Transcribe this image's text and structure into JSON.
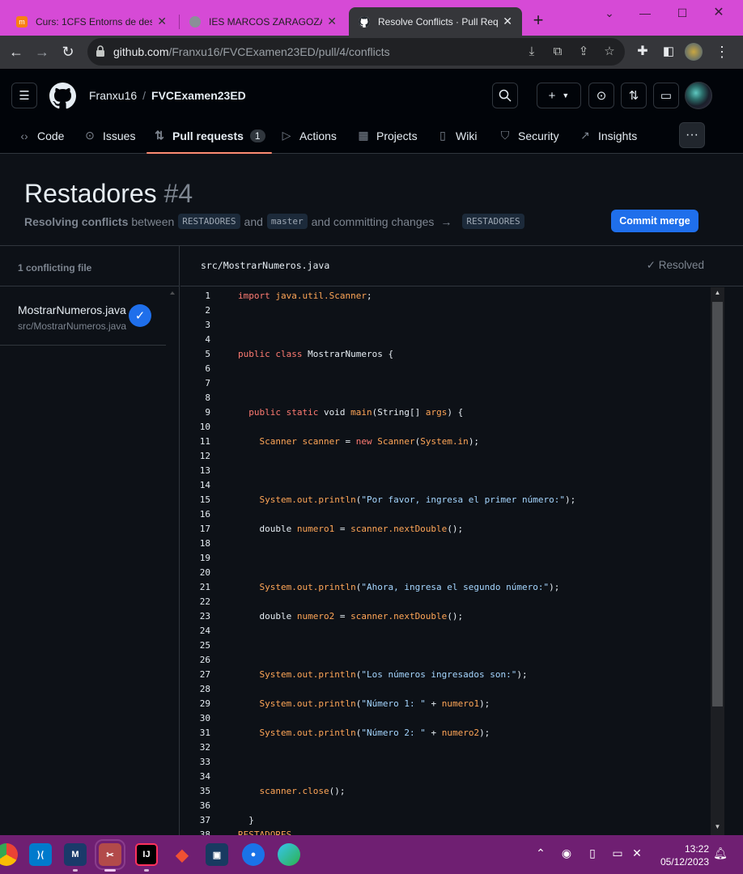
{
  "browser": {
    "tabs": [
      {
        "title": "Curs: 1CFS Entorns de dese",
        "icon": "moodle-icon"
      },
      {
        "title": "IES MARCOS ZARAGOZA",
        "icon": "globe-icon"
      },
      {
        "title": "Resolve Conflicts · Pull Requ",
        "icon": "github-icon"
      }
    ],
    "new_tab": "+",
    "url_host": "github.com",
    "url_path": "/Franxu16/FVCExamen23ED/pull/4/conflicts"
  },
  "github": {
    "owner": "Franxu16",
    "separator": "/",
    "repo": "FVCExamen23ED",
    "nav": {
      "code": "Code",
      "issues": "Issues",
      "pulls": "Pull requests",
      "pulls_count": "1",
      "actions": "Actions",
      "projects": "Projects",
      "wiki": "Wiki",
      "security": "Security",
      "insights": "Insights"
    },
    "title": "Restadores",
    "number": "#4",
    "sub_resolving": "Resolving conflicts",
    "sub_between": "between",
    "head_branch": "RESTADORES",
    "sub_and": "and",
    "base_branch": "master",
    "sub_committing": "and committing changes",
    "target_branch": "RESTADORES",
    "commit_button": "Commit merge",
    "sidebar_header": "1 conflicting file",
    "file": {
      "name": "MostrarNumeros.java",
      "path": "src/MostrarNumeros.java"
    },
    "editor_path": "src/MostrarNumeros.java",
    "resolved_label": "Resolved"
  },
  "code_lines": [
    {
      "n": "1",
      "html": "<span class=\"kw\">import</span> <span class=\"ty\">java.util.Scanner</span>;"
    },
    {
      "n": "2",
      "html": ""
    },
    {
      "n": "3",
      "html": ""
    },
    {
      "n": "4",
      "html": ""
    },
    {
      "n": "5",
      "html": "<span class=\"kw\">public</span> <span class=\"kw\">class</span> MostrarNumeros {"
    },
    {
      "n": "6",
      "html": ""
    },
    {
      "n": "7",
      "html": ""
    },
    {
      "n": "8",
      "html": ""
    },
    {
      "n": "9",
      "html": "  <span class=\"kw\">public</span> <span class=\"kw\">static</span> void <span class=\"ty\">main</span>(String[] <span class=\"vr\">args</span>) {"
    },
    {
      "n": "10",
      "html": ""
    },
    {
      "n": "11",
      "html": "    <span class=\"ty\">Scanner</span> <span class=\"ty\">scanner</span> = <span class=\"kw\">new</span> <span class=\"ty\">Scanner</span>(<span class=\"ty\">System.in</span>);"
    },
    {
      "n": "12",
      "html": ""
    },
    {
      "n": "13",
      "html": ""
    },
    {
      "n": "14",
      "html": ""
    },
    {
      "n": "15",
      "html": "    <span class=\"ty\">System.out.println</span>(<span class=\"st\">\"Por favor, ingresa el primer número:\"</span>);"
    },
    {
      "n": "16",
      "html": ""
    },
    {
      "n": "17",
      "html": "    double <span class=\"vr\">numero1</span> = <span class=\"ty\">scanner.nextDouble</span>();"
    },
    {
      "n": "18",
      "html": ""
    },
    {
      "n": "19",
      "html": ""
    },
    {
      "n": "20",
      "html": ""
    },
    {
      "n": "21",
      "html": "    <span class=\"ty\">System.out.println</span>(<span class=\"st\">\"Ahora, ingresa el segundo número:\"</span>);"
    },
    {
      "n": "22",
      "html": ""
    },
    {
      "n": "23",
      "html": "    double <span class=\"vr\">numero2</span> = <span class=\"ty\">scanner.nextDouble</span>();"
    },
    {
      "n": "24",
      "html": ""
    },
    {
      "n": "25",
      "html": ""
    },
    {
      "n": "26",
      "html": ""
    },
    {
      "n": "27",
      "html": "    <span class=\"ty\">System.out.println</span>(<span class=\"st\">\"Los números ingresados son:\"</span>);"
    },
    {
      "n": "28",
      "html": ""
    },
    {
      "n": "29",
      "html": "    <span class=\"ty\">System.out.println</span>(<span class=\"st\">\"Número 1: \"</span> + <span class=\"vr\">numero1</span>);"
    },
    {
      "n": "30",
      "html": ""
    },
    {
      "n": "31",
      "html": "    <span class=\"ty\">System.out.println</span>(<span class=\"st\">\"Número 2: \"</span> + <span class=\"vr\">numero2</span>);"
    },
    {
      "n": "32",
      "html": ""
    },
    {
      "n": "33",
      "html": ""
    },
    {
      "n": "34",
      "html": ""
    },
    {
      "n": "35",
      "html": "    <span class=\"ty\">scanner.close</span>();"
    },
    {
      "n": "36",
      "html": ""
    },
    {
      "n": "37",
      "html": "  }"
    },
    {
      "n": "38",
      "html": "<span class=\"ty\">RESTADORES</span>"
    }
  ],
  "taskbar": {
    "apps": [
      "chrome",
      "vscode",
      "mcmm",
      "snipping-tool",
      "intellij",
      "git",
      "virtualbox",
      "maps",
      "edge"
    ],
    "time": "13:22",
    "date": "05/12/2023"
  },
  "colors": {
    "tabstrip": "#d64ad6",
    "taskbar": "#6f1f72",
    "accent": "#1f6feb",
    "selected_tab_underline": "#fd8c73"
  }
}
